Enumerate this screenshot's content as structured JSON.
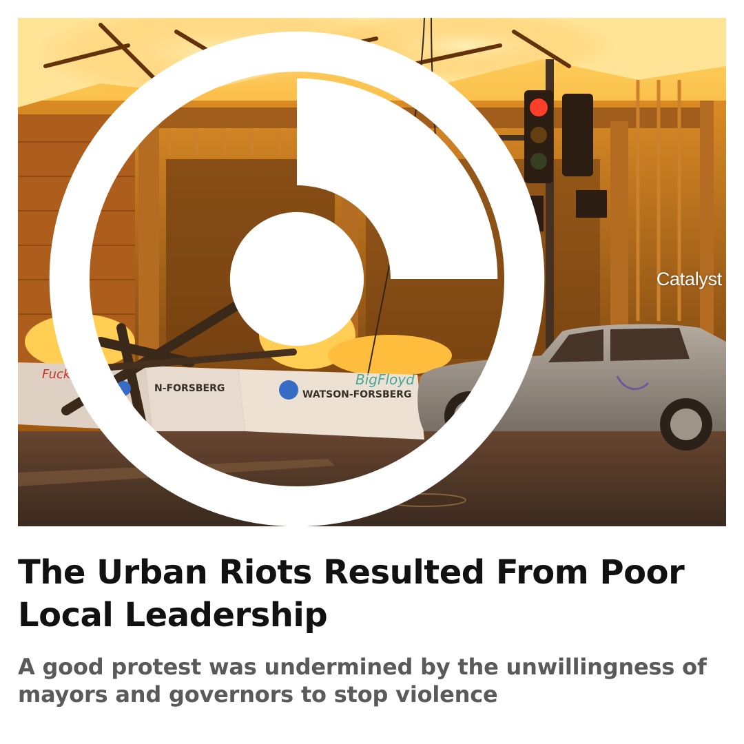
{
  "brand": {
    "name": "Catalyst",
    "icon": "catalyst-logo-icon"
  },
  "photo": {
    "signs": {
      "company": "WATSON-FORSBERG",
      "company_partial": "N-FORSBERG",
      "graffiti": "BigFloyd",
      "graffiti_left": "Fuck"
    }
  },
  "article": {
    "headline": "The Urban Riots Resulted From Poor Local Leadership",
    "subhead": "A good protest was undermined by the unwillingness of mayors and governors to stop violence"
  },
  "colors": {
    "headline": "#111111",
    "subhead": "#5a5a5a",
    "fire": "#ff9a1a",
    "background": "#ffffff"
  }
}
